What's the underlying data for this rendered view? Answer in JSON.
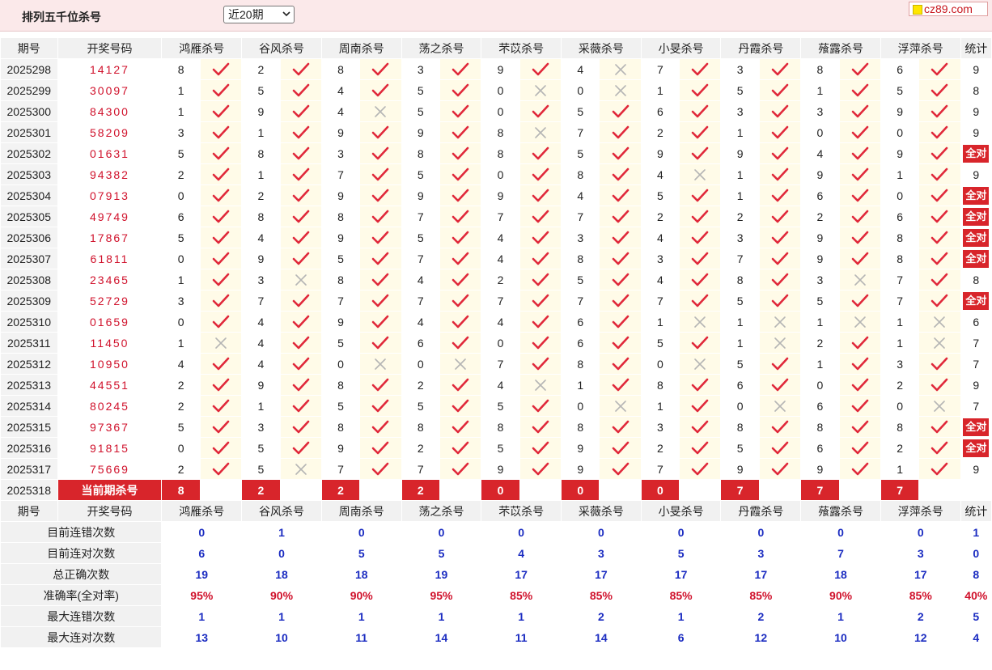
{
  "header": {
    "title": "排列五千位杀号",
    "period_select": "近20期",
    "logo_text": "cz89.com"
  },
  "columns": {
    "period": "期号",
    "draw": "开奖号码",
    "experts": [
      "鸿雁杀号",
      "谷风杀号",
      "周南杀号",
      "荡之杀号",
      "芣苡杀号",
      "采薇杀号",
      "小旻杀号",
      "丹霞杀号",
      "蕵露杀号",
      "浮萍杀号"
    ],
    "stat": "统计"
  },
  "rows": [
    {
      "period": "2025298",
      "draw": "14127",
      "kills": [
        8,
        2,
        8,
        3,
        9,
        4,
        7,
        3,
        8,
        6
      ],
      "ok": [
        1,
        1,
        1,
        1,
        1,
        0,
        1,
        1,
        1,
        1
      ],
      "stat": "9"
    },
    {
      "period": "2025299",
      "draw": "30097",
      "kills": [
        1,
        5,
        4,
        5,
        0,
        0,
        1,
        5,
        1,
        5
      ],
      "ok": [
        1,
        1,
        1,
        1,
        0,
        0,
        1,
        1,
        1,
        1
      ],
      "stat": "8"
    },
    {
      "period": "2025300",
      "draw": "84300",
      "kills": [
        1,
        9,
        4,
        5,
        0,
        5,
        6,
        3,
        3,
        9
      ],
      "ok": [
        1,
        1,
        0,
        1,
        1,
        1,
        1,
        1,
        1,
        1
      ],
      "stat": "9"
    },
    {
      "period": "2025301",
      "draw": "58209",
      "kills": [
        3,
        1,
        9,
        9,
        8,
        7,
        2,
        1,
        0,
        0
      ],
      "ok": [
        1,
        1,
        1,
        1,
        0,
        1,
        1,
        1,
        1,
        1
      ],
      "stat": "9"
    },
    {
      "period": "2025302",
      "draw": "01631",
      "kills": [
        5,
        8,
        3,
        8,
        8,
        5,
        9,
        9,
        4,
        9
      ],
      "ok": [
        1,
        1,
        1,
        1,
        1,
        1,
        1,
        1,
        1,
        1
      ],
      "stat": "全对"
    },
    {
      "period": "2025303",
      "draw": "94382",
      "kills": [
        2,
        1,
        7,
        5,
        0,
        8,
        4,
        1,
        9,
        1
      ],
      "ok": [
        1,
        1,
        1,
        1,
        1,
        1,
        0,
        1,
        1,
        1
      ],
      "stat": "9"
    },
    {
      "period": "2025304",
      "draw": "07913",
      "kills": [
        0,
        2,
        9,
        9,
        9,
        4,
        5,
        1,
        6,
        0
      ],
      "ok": [
        1,
        1,
        1,
        1,
        1,
        1,
        1,
        1,
        1,
        1
      ],
      "stat": "全对"
    },
    {
      "period": "2025305",
      "draw": "49749",
      "kills": [
        6,
        8,
        8,
        7,
        7,
        7,
        2,
        2,
        2,
        6
      ],
      "ok": [
        1,
        1,
        1,
        1,
        1,
        1,
        1,
        1,
        1,
        1
      ],
      "stat": "全对"
    },
    {
      "period": "2025306",
      "draw": "17867",
      "kills": [
        5,
        4,
        9,
        5,
        4,
        3,
        4,
        3,
        9,
        8
      ],
      "ok": [
        1,
        1,
        1,
        1,
        1,
        1,
        1,
        1,
        1,
        1
      ],
      "stat": "全对"
    },
    {
      "period": "2025307",
      "draw": "61811",
      "kills": [
        0,
        9,
        5,
        7,
        4,
        8,
        3,
        7,
        9,
        8
      ],
      "ok": [
        1,
        1,
        1,
        1,
        1,
        1,
        1,
        1,
        1,
        1
      ],
      "stat": "全对"
    },
    {
      "period": "2025308",
      "draw": "23465",
      "kills": [
        1,
        3,
        8,
        4,
        2,
        5,
        4,
        8,
        3,
        7
      ],
      "ok": [
        1,
        0,
        1,
        1,
        1,
        1,
        1,
        1,
        0,
        1
      ],
      "stat": "8"
    },
    {
      "period": "2025309",
      "draw": "52729",
      "kills": [
        3,
        7,
        7,
        7,
        7,
        7,
        7,
        5,
        5,
        7
      ],
      "ok": [
        1,
        1,
        1,
        1,
        1,
        1,
        1,
        1,
        1,
        1
      ],
      "stat": "全对"
    },
    {
      "period": "2025310",
      "draw": "01659",
      "kills": [
        0,
        4,
        9,
        4,
        4,
        6,
        1,
        1,
        1,
        1
      ],
      "ok": [
        1,
        1,
        1,
        1,
        1,
        1,
        0,
        0,
        0,
        0
      ],
      "stat": "6"
    },
    {
      "period": "2025311",
      "draw": "11450",
      "kills": [
        1,
        4,
        5,
        6,
        0,
        6,
        5,
        1,
        2,
        1
      ],
      "ok": [
        0,
        1,
        1,
        1,
        1,
        1,
        1,
        0,
        1,
        0
      ],
      "stat": "7"
    },
    {
      "period": "2025312",
      "draw": "10950",
      "kills": [
        4,
        4,
        0,
        0,
        7,
        8,
        0,
        5,
        1,
        3
      ],
      "ok": [
        1,
        1,
        0,
        0,
        1,
        1,
        0,
        1,
        1,
        1
      ],
      "stat": "7"
    },
    {
      "period": "2025313",
      "draw": "44551",
      "kills": [
        2,
        9,
        8,
        2,
        4,
        1,
        8,
        6,
        0,
        2
      ],
      "ok": [
        1,
        1,
        1,
        1,
        0,
        1,
        1,
        1,
        1,
        1
      ],
      "stat": "9"
    },
    {
      "period": "2025314",
      "draw": "80245",
      "kills": [
        2,
        1,
        5,
        5,
        5,
        0,
        1,
        0,
        6,
        0
      ],
      "ok": [
        1,
        1,
        1,
        1,
        1,
        0,
        1,
        0,
        1,
        0
      ],
      "stat": "7"
    },
    {
      "period": "2025315",
      "draw": "97367",
      "kills": [
        5,
        3,
        8,
        8,
        8,
        8,
        3,
        8,
        8,
        8
      ],
      "ok": [
        1,
        1,
        1,
        1,
        1,
        1,
        1,
        1,
        1,
        1
      ],
      "stat": "全对"
    },
    {
      "period": "2025316",
      "draw": "91815",
      "kills": [
        0,
        5,
        9,
        2,
        5,
        9,
        2,
        5,
        6,
        2
      ],
      "ok": [
        1,
        1,
        1,
        1,
        1,
        1,
        1,
        1,
        1,
        1
      ],
      "stat": "全对"
    },
    {
      "period": "2025317",
      "draw": "75669",
      "kills": [
        2,
        5,
        7,
        7,
        9,
        9,
        7,
        9,
        9,
        1
      ],
      "ok": [
        1,
        0,
        1,
        1,
        1,
        1,
        1,
        1,
        1,
        1
      ],
      "stat": "9"
    }
  ],
  "current": {
    "period": "2025318",
    "label": "当前期杀号",
    "kills": [
      "8",
      "2",
      "2",
      "2",
      "0",
      "0",
      "0",
      "7",
      "7",
      "7"
    ]
  },
  "summary": [
    {
      "label": "目前连错次数",
      "values": [
        "0",
        "1",
        "0",
        "0",
        "0",
        "0",
        "0",
        "0",
        "0",
        "0"
      ],
      "stat": "1",
      "style": "val"
    },
    {
      "label": "目前连对次数",
      "values": [
        "6",
        "0",
        "5",
        "5",
        "4",
        "3",
        "5",
        "3",
        "7",
        "3"
      ],
      "stat": "0",
      "style": "val"
    },
    {
      "label": "总正确次数",
      "values": [
        "19",
        "18",
        "18",
        "19",
        "17",
        "17",
        "17",
        "17",
        "18",
        "17"
      ],
      "stat": "8",
      "style": "val"
    },
    {
      "label": "准确率(全对率)",
      "values": [
        "95%",
        "90%",
        "90%",
        "95%",
        "85%",
        "85%",
        "85%",
        "85%",
        "90%",
        "85%"
      ],
      "stat": "40%",
      "style": "pct"
    },
    {
      "label": "最大连错次数",
      "values": [
        "1",
        "1",
        "1",
        "1",
        "1",
        "2",
        "1",
        "2",
        "1",
        "2"
      ],
      "stat": "5",
      "style": "val"
    },
    {
      "label": "最大连对次数",
      "values": [
        "13",
        "10",
        "11",
        "14",
        "11",
        "14",
        "6",
        "12",
        "10",
        "12"
      ],
      "stat": "4",
      "style": "val"
    }
  ],
  "colors": {
    "check": "#e0283a",
    "cross": "#b5b5b5",
    "accent": "#d8252b",
    "summary_blue": "#1b2cc1"
  }
}
